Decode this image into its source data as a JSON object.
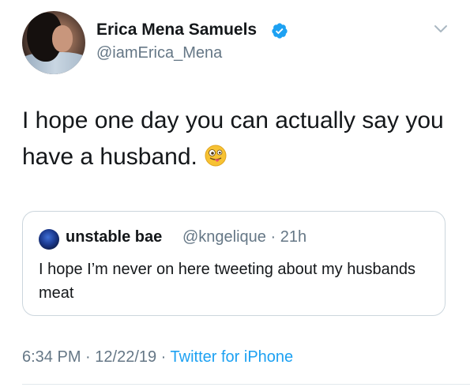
{
  "tweet": {
    "author_name": "Erica Mena Samuels",
    "author_handle": "@iamErica_Mena",
    "text": "I hope one day you can actually say you have a husband.",
    "time": "6:34 PM",
    "date": "12/22/19",
    "source": "Twitter for iPhone",
    "separator": " · "
  },
  "quoted": {
    "author_name": "unstable bae",
    "author_handle": "@kngelique",
    "age": "21h",
    "separator": " · ",
    "text": "I hope I’m never on here tweeting about my husbands meat"
  },
  "colors": {
    "link": "#1da1f2",
    "secondary_text": "#657786",
    "border": "#ccd6dd"
  },
  "icons": {
    "verified": "verified-badge-icon",
    "menu": "chevron-down-icon",
    "emoji": "winking-face-with-tongue-emoji"
  }
}
